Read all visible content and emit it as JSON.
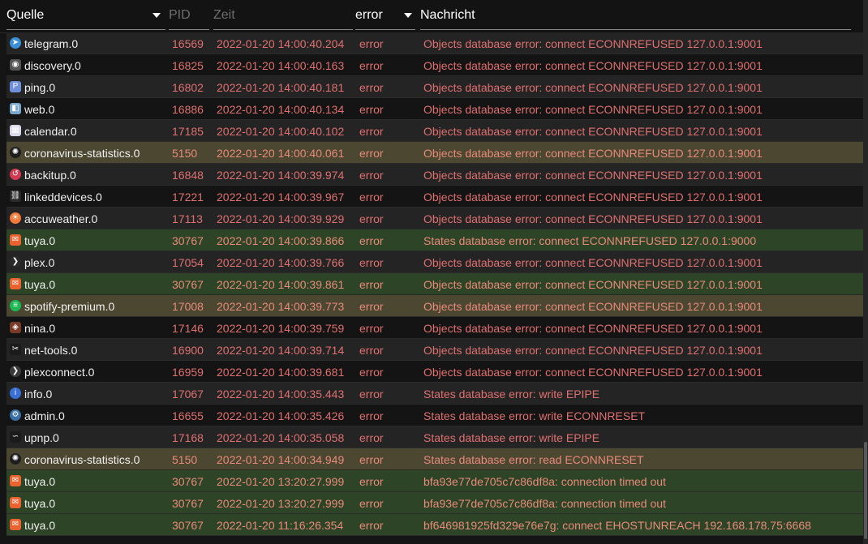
{
  "header": {
    "source_label": "Quelle",
    "pid_label": "PID",
    "time_label": "Zeit",
    "level_label": "error",
    "message_label": "Nachricht"
  },
  "colors": {
    "error_text": "#e07070",
    "highlight_olive": "#4b4731",
    "highlight_green": "#2e4427"
  },
  "rows": [
    {
      "source": "telegram.0",
      "icon": "telegram-icon",
      "pid": "16569",
      "time": "2022-01-20 14:00:40.204",
      "level": "error",
      "message": "Objects database error: connect ECONNREFUSED 127.0.0.1:9001",
      "highlight": "none"
    },
    {
      "source": "discovery.0",
      "icon": "discovery-icon",
      "pid": "16825",
      "time": "2022-01-20 14:00:40.163",
      "level": "error",
      "message": "Objects database error: connect ECONNREFUSED 127.0.0.1:9001",
      "highlight": "none"
    },
    {
      "source": "ping.0",
      "icon": "ping-icon",
      "pid": "16802",
      "time": "2022-01-20 14:00:40.181",
      "level": "error",
      "message": "Objects database error: connect ECONNREFUSED 127.0.0.1:9001",
      "highlight": "none"
    },
    {
      "source": "web.0",
      "icon": "web-icon",
      "pid": "16886",
      "time": "2022-01-20 14:00:40.134",
      "level": "error",
      "message": "Objects database error: connect ECONNREFUSED 127.0.0.1:9001",
      "highlight": "none"
    },
    {
      "source": "calendar.0",
      "icon": "calendar-icon",
      "pid": "17185",
      "time": "2022-01-20 14:00:40.102",
      "level": "error",
      "message": "Objects database error: connect ECONNREFUSED 127.0.0.1:9001",
      "highlight": "none"
    },
    {
      "source": "coronavirus-statistics.0",
      "icon": "virus-icon",
      "pid": "5150",
      "time": "2022-01-20 14:00:40.061",
      "level": "error",
      "message": "Objects database error: connect ECONNREFUSED 127.0.0.1:9001",
      "highlight": "olive"
    },
    {
      "source": "backitup.0",
      "icon": "backup-icon",
      "pid": "16848",
      "time": "2022-01-20 14:00:39.974",
      "level": "error",
      "message": "Objects database error: connect ECONNREFUSED 127.0.0.1:9001",
      "highlight": "none"
    },
    {
      "source": "linkeddevices.0",
      "icon": "link-icon",
      "pid": "17221",
      "time": "2022-01-20 14:00:39.967",
      "level": "error",
      "message": "Objects database error: connect ECONNREFUSED 127.0.0.1:9001",
      "highlight": "none"
    },
    {
      "source": "accuweather.0",
      "icon": "weather-icon",
      "pid": "17113",
      "time": "2022-01-20 14:00:39.929",
      "level": "error",
      "message": "Objects database error: connect ECONNREFUSED 127.0.0.1:9001",
      "highlight": "none"
    },
    {
      "source": "tuya.0",
      "icon": "tuya-icon",
      "pid": "30767",
      "time": "2022-01-20 14:00:39.866",
      "level": "error",
      "message": "States database error: connect ECONNREFUSED 127.0.0.1:9000",
      "highlight": "green"
    },
    {
      "source": "plex.0",
      "icon": "plex-icon",
      "pid": "17054",
      "time": "2022-01-20 14:00:39.766",
      "level": "error",
      "message": "Objects database error: connect ECONNREFUSED 127.0.0.1:9001",
      "highlight": "none"
    },
    {
      "source": "tuya.0",
      "icon": "tuya-icon",
      "pid": "30767",
      "time": "2022-01-20 14:00:39.861",
      "level": "error",
      "message": "Objects database error: connect ECONNREFUSED 127.0.0.1:9001",
      "highlight": "green"
    },
    {
      "source": "spotify-premium.0",
      "icon": "spotify-icon",
      "pid": "17008",
      "time": "2022-01-20 14:00:39.773",
      "level": "error",
      "message": "Objects database error: connect ECONNREFUSED 127.0.0.1:9001",
      "highlight": "olive"
    },
    {
      "source": "nina.0",
      "icon": "nina-icon",
      "pid": "17146",
      "time": "2022-01-20 14:00:39.759",
      "level": "error",
      "message": "Objects database error: connect ECONNREFUSED 127.0.0.1:9001",
      "highlight": "none"
    },
    {
      "source": "net-tools.0",
      "icon": "net-tools-icon",
      "pid": "16900",
      "time": "2022-01-20 14:00:39.714",
      "level": "error",
      "message": "Objects database error: connect ECONNREFUSED 127.0.0.1:9001",
      "highlight": "none"
    },
    {
      "source": "plexconnect.0",
      "icon": "plexconnect-icon",
      "pid": "16959",
      "time": "2022-01-20 14:00:39.681",
      "level": "error",
      "message": "Objects database error: connect ECONNREFUSED 127.0.0.1:9001",
      "highlight": "none"
    },
    {
      "source": "info.0",
      "icon": "info-icon",
      "pid": "17067",
      "time": "2022-01-20 14:00:35.443",
      "level": "error",
      "message": "States database error: write EPIPE",
      "highlight": "none"
    },
    {
      "source": "admin.0",
      "icon": "admin-gear-icon",
      "pid": "16655",
      "time": "2022-01-20 14:00:35.426",
      "level": "error",
      "message": "States database error: write ECONNRESET",
      "highlight": "none"
    },
    {
      "source": "upnp.0",
      "icon": "upnp-icon",
      "pid": "17168",
      "time": "2022-01-20 14:00:35.058",
      "level": "error",
      "message": "States database error: write EPIPE",
      "highlight": "none"
    },
    {
      "source": "coronavirus-statistics.0",
      "icon": "virus-icon",
      "pid": "5150",
      "time": "2022-01-20 14:00:34.949",
      "level": "error",
      "message": "States database error: read ECONNRESET",
      "highlight": "olive"
    },
    {
      "source": "tuya.0",
      "icon": "tuya-icon",
      "pid": "30767",
      "time": "2022-01-20 13:20:27.999",
      "level": "error",
      "message": "bfa93e77de705c7c86df8a: connection timed out",
      "highlight": "green"
    },
    {
      "source": "tuya.0",
      "icon": "tuya-icon",
      "pid": "30767",
      "time": "2022-01-20 13:20:27.999",
      "level": "error",
      "message": "bfa93e77de705c7c86df8a: connection timed out",
      "highlight": "green"
    },
    {
      "source": "tuya.0",
      "icon": "tuya-icon",
      "pid": "30767",
      "time": "2022-01-20 11:16:26.354",
      "level": "error",
      "message": "bf646981925fd329e76e7g: connect EHOSTUNREACH 192.168.178.75:6668",
      "highlight": "green"
    }
  ]
}
